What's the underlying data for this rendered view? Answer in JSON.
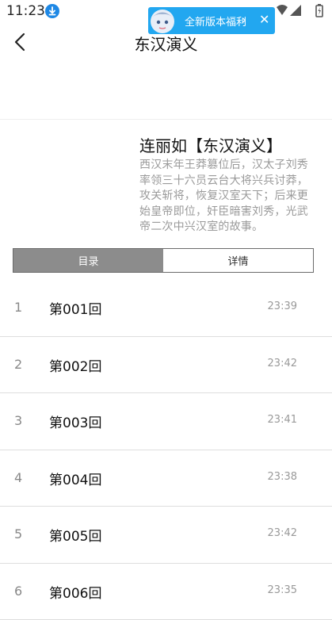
{
  "status_bar": {
    "time": "11:23",
    "icons": [
      "download-badge-icon",
      "wifi-icon",
      "cellular-signal-icon",
      "battery-icon"
    ]
  },
  "banner": {
    "text": "全新版本福利",
    "chevron": "›",
    "close": "✕"
  },
  "header": {
    "title": "东汉演义"
  },
  "book": {
    "title": "连丽如【东汉演义】",
    "description": "西汉末年王莽篡位后，汉太子刘秀率领三十六员云台大将兴兵讨莽，攻关斩将，恢复汉室天下；后来更始皇帝即位，奸臣暗害刘秀，光武帝二次中兴汉室的故事。"
  },
  "tabs": [
    {
      "label": "目录",
      "active": true
    },
    {
      "label": "详情",
      "active": false
    }
  ],
  "chapters": [
    {
      "num": "1",
      "title": "第001回",
      "time": "23:39"
    },
    {
      "num": "2",
      "title": "第002回",
      "time": "23:42"
    },
    {
      "num": "3",
      "title": "第003回",
      "time": "23:41"
    },
    {
      "num": "4",
      "title": "第004回",
      "time": "23:38"
    },
    {
      "num": "5",
      "title": "第005回",
      "time": "23:42"
    },
    {
      "num": "6",
      "title": "第006回",
      "time": "23:35"
    }
  ],
  "colors": {
    "banner": "#22a7f0",
    "tab_active_bg": "#8c8c8c",
    "description_text": "#9a9a9a",
    "divider": "#dedede"
  }
}
